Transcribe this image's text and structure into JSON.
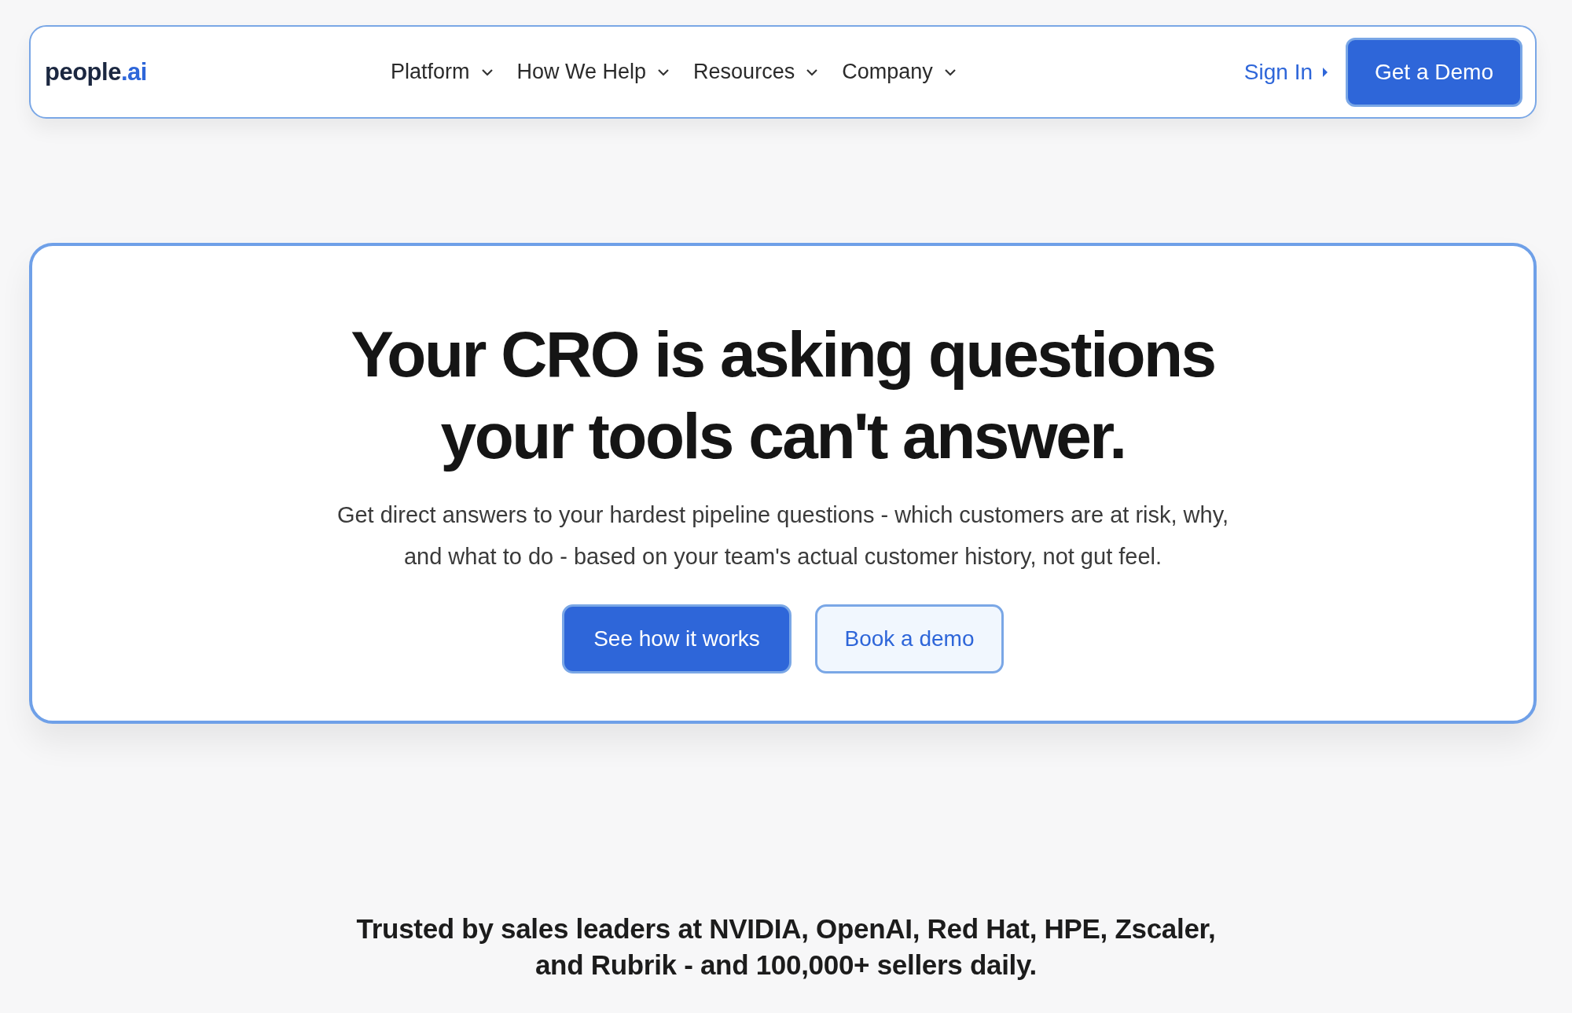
{
  "header": {
    "logo": {
      "word": "people",
      "suffix": ".ai"
    },
    "nav": [
      {
        "label": "Platform",
        "has_menu": true
      },
      {
        "label": "How We Help",
        "has_menu": true
      },
      {
        "label": "Resources",
        "has_menu": true
      },
      {
        "label": "Company",
        "has_menu": true
      }
    ],
    "sign_in": "Sign In",
    "cta": "Get a Demo"
  },
  "hero": {
    "title_lines": [
      "Your CRO is asking questions",
      "your tools can't answer."
    ],
    "subtitle": "Get direct answers to your hardest pipeline questions - which customers are at risk, why, and what to do - based on your team's actual customer history, not gut feel.",
    "buttons": [
      {
        "label": "See how it works",
        "kind": "primary"
      },
      {
        "label": "Book a demo",
        "kind": "secondary"
      }
    ]
  },
  "trust": {
    "lines": [
      "Trusted by sales leaders at NVIDIA, OpenAI, Red Hat, HPE, Zscaler,",
      "and Rubrik - and 100,000+ sellers daily."
    ]
  }
}
